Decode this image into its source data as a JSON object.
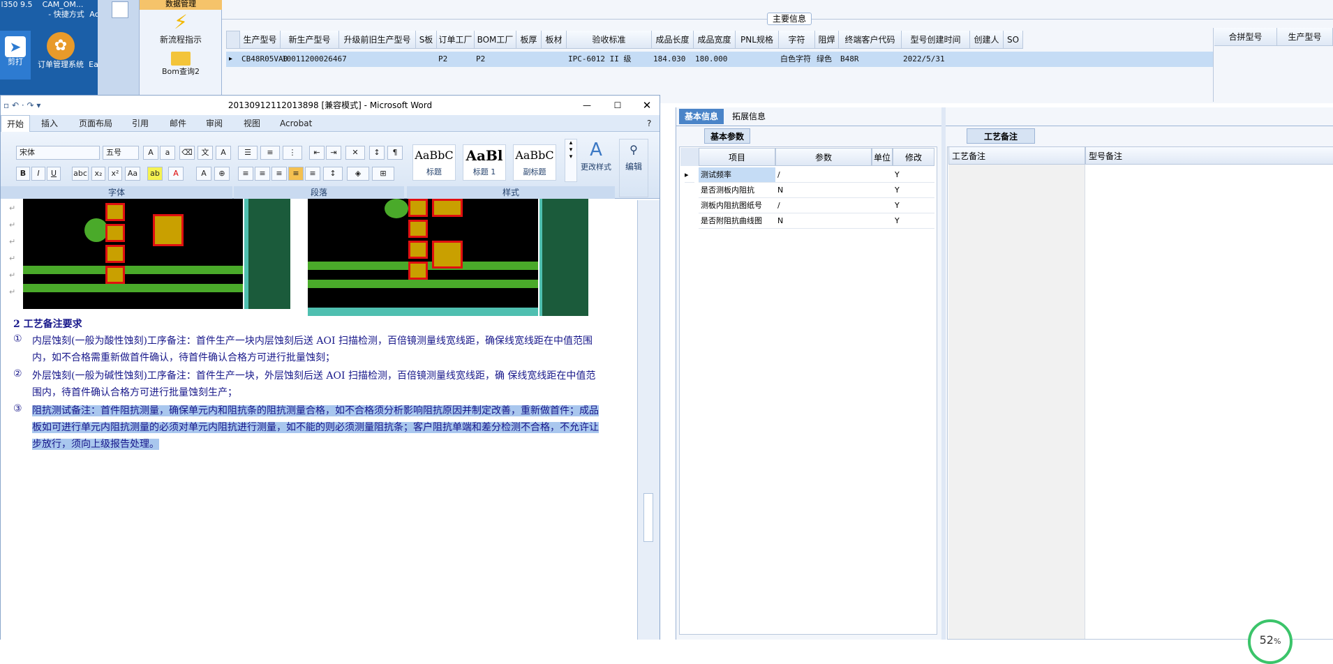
{
  "desktop": {
    "top_labels": [
      "l350 9.5",
      "CAM_OM...",
      "- 快捷方式",
      "Ac"
    ],
    "icons": [
      {
        "icon": "arrow-app-icon",
        "label": "剪打"
      },
      {
        "icon": "shell-icon",
        "label": "订单管理系统"
      },
      {
        "icon": "app-icon",
        "label": "Ea"
      }
    ]
  },
  "nav": {
    "header": "数据管理",
    "items": [
      {
        "icon": "lightning-icon",
        "label": "新流程指示"
      },
      {
        "icon": "folder-icon",
        "label": "Bom查询2"
      }
    ]
  },
  "main_info": {
    "title": "主要信息",
    "columns": [
      "生产型号",
      "新生产型号",
      "升级前旧生产型号",
      "S板",
      "订单工厂",
      "BOM工厂",
      "板厚",
      "板材",
      "验收标准",
      "成品长度",
      "成品宽度",
      "PNL规格",
      "字符",
      "阻焊",
      "终端客户代码",
      "型号创建时间",
      "创建人",
      "SO"
    ],
    "row": [
      "CB48R05VA0",
      "10011200026467",
      "",
      "",
      "P2",
      "P2",
      "",
      "",
      "IPC-6012 II 级",
      "184.030",
      "180.000",
      "",
      "白色字符",
      "绿色",
      "B48R",
      "2022/5/31",
      "",
      ""
    ],
    "side_columns": [
      "合拼型号",
      "生产型号"
    ]
  },
  "word": {
    "title": "20130912112013898 [兼容模式] - Microsoft Word",
    "tabs": [
      "开始",
      "插入",
      "页面布局",
      "引用",
      "邮件",
      "审阅",
      "视图",
      "Acrobat"
    ],
    "font_name": "宋体",
    "font_size": "五号",
    "styles": [
      {
        "preview": "AaBbC",
        "label": "标题"
      },
      {
        "preview": "AaBl",
        "label": "标题 1"
      },
      {
        "preview": "AaBbC",
        "label": "副标题"
      }
    ],
    "change_style": "更改样式",
    "edit": "编辑",
    "groups": [
      "字体",
      "段落",
      "样式"
    ],
    "heading": "2 工艺备注要求",
    "paragraphs": [
      {
        "num": "①",
        "text": "内层蚀刻(一般为酸性蚀刻)工序备注：首件生产一块内层蚀刻后送 AOI 扫描检测，百倍镜测量线宽线距，确保线宽线距在中值范围内，如不合格需重新做首件确认，待首件确认合格方可进行批量蚀刻；"
      },
      {
        "num": "②",
        "text": "外层蚀刻(一般为碱性蚀刻)工序备注：首件生产一块，外层蚀刻后送 AOI 扫描检测，百倍镜测量线宽线距，确 保线宽线距在中值范围内，待首件确认合格方可进行批量蚀刻生产；"
      },
      {
        "num": "③",
        "text": "阻抗测试备注：首件阻抗测量，确保单元内和阻抗条的阻抗测量合格，如不合格须分析影响阻抗原因并制定改善，重新做首件；成品板如可进行单元内阻抗测量的必须对单元内阻抗进行测量，如不能的则必须测量阻抗条；客户阻抗单端和差分检测不合格，不允许让步放行，须向上级报告处理。"
      }
    ]
  },
  "right": {
    "tabs": [
      "基本信息",
      "拓展信息"
    ],
    "sub_tab": "基本参数",
    "columns": [
      "项目",
      "参数",
      "单位",
      "修改"
    ],
    "rows": [
      {
        "item": "测试频率",
        "param": "/",
        "unit": "",
        "edit": "Y"
      },
      {
        "item": "是否测板内阻抗",
        "param": "N",
        "unit": "",
        "edit": "Y"
      },
      {
        "item": "测板内阻抗图纸号",
        "param": "/",
        "unit": "",
        "edit": "Y"
      },
      {
        "item": "是否附阻抗曲线图",
        "param": "N",
        "unit": "",
        "edit": "Y"
      }
    ],
    "craft_tab": "工艺备注",
    "craft_columns": [
      "工艺备注",
      "型号备注"
    ]
  },
  "progress": {
    "value": "52",
    "unit": "%"
  }
}
